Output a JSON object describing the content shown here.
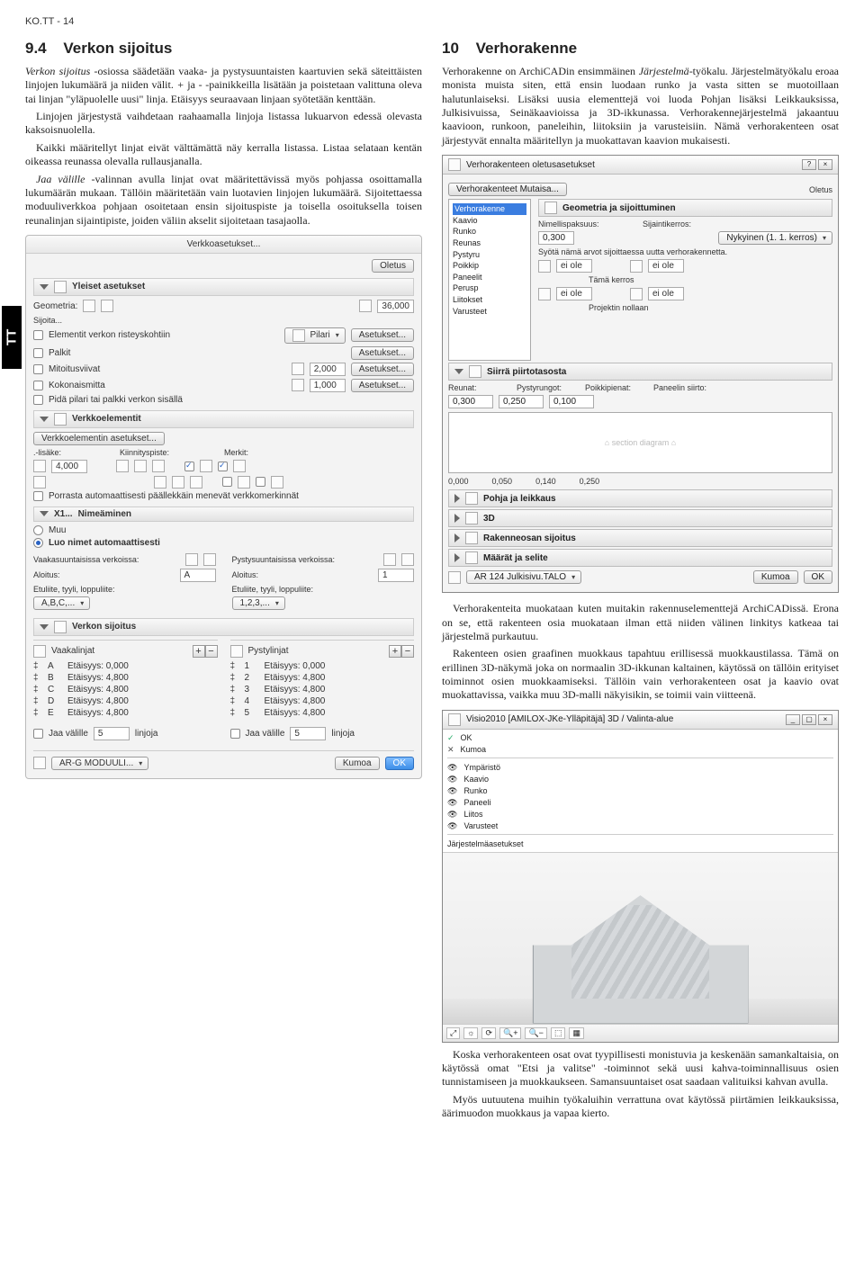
{
  "header": "KO.TT - 14",
  "tab": "TT",
  "left": {
    "sec_num": "9.4",
    "sec_title": "Verkon sijoitus",
    "p1": "Verkon sijoitus -osiossa säädetään vaaka- ja pystysuuntaisten kaartuvien sekä säteittäisten linjojen lukumäärä ja niiden välit. + ja - -painikkeilla lisätään ja poistetaan valittuna oleva tai linjan \"yläpuolelle uusi\" linja. Etäisyys seuraavaan linjaan syötetään kenttään.",
    "p2": "Linjojen järjestystä vaihdetaan raahaamalla linjoja listassa lukuarvon edessä olevasta kaksoisnuolella.",
    "p3": "Kaikki määritellyt linjat eivät välttämättä näy kerralla listassa. Listaa selataan kentän oikeassa reunassa olevalla rullausjanalla.",
    "p4": "Jaa välille -valinnan avulla linjat ovat määritettävissä myös pohjassa osoittamalla lukumäärän mukaan. Tällöin määritetään vain luotavien linjojen lukumäärä. Sijoitettaessa moduuliverkkoa pohjaan osoitetaan ensin sijoituspiste ja toisella osoituksella toisen reunalinjan sijaintipiste, joiden väliin akselit sijoitetaan tasajaolla."
  },
  "dlg1": {
    "title": "Verkkoasetukset...",
    "oletus": "Oletus",
    "yleiset": "Yleiset asetukset",
    "geometria": "Geometria:",
    "geo_val": "36,000",
    "sijoita": "Sijoita...",
    "r1": "Elementit verkon risteyskohtiin",
    "pilari": "Pilari",
    "asetukset": "Asetukset...",
    "r2": "Palkit",
    "r3": "Mitoitusviivat",
    "r3_val": "2,000",
    "r4": "Kokonaismitta",
    "r4_val": "1,000",
    "r5": "Pidä pilari tai palkki verkon sisällä",
    "verkkoelementit": "Verkkoelementit",
    "ve_btn": "Verkkoelementin asetukset...",
    "lisake": ".-lisäke:",
    "lisake_val": "4,000",
    "kiin": "Kiinnityspiste:",
    "merkit": "Merkit:",
    "porrasta": "Porrasta automaattisesti päällekkäin menevät verkkomerkinnät",
    "nimeaminen": "Nimeäminen",
    "x1": "X1...",
    "muu": "Muu",
    "luo": "Luo nimet automaattisesti",
    "vv": "Vaakasuuntaisissa verkoissa:",
    "pv": "Pystysuuntaisissa verkoissa:",
    "aloitus": "Aloitus:",
    "a_v": "A",
    "a_p": "1",
    "etl": "Etuliite, tyyli, loppuliite:",
    "etl_v": "A,B,C,...",
    "etl_p": "1,2,3,...",
    "sijoitus": "Verkon sijoitus",
    "vaakalinjat": "Vaakalinjat",
    "pystylinjat": "Pystylinjat",
    "v_rows": [
      {
        "n": "A",
        "t": "Etäisyys: 0,000"
      },
      {
        "n": "B",
        "t": "Etäisyys: 4,800"
      },
      {
        "n": "C",
        "t": "Etäisyys: 4,800"
      },
      {
        "n": "D",
        "t": "Etäisyys: 4,800"
      },
      {
        "n": "E",
        "t": "Etäisyys: 4,800"
      }
    ],
    "p_rows": [
      {
        "n": "1",
        "t": "Etäisyys: 0,000"
      },
      {
        "n": "2",
        "t": "Etäisyys: 4,800"
      },
      {
        "n": "3",
        "t": "Etäisyys: 4,800"
      },
      {
        "n": "4",
        "t": "Etäisyys: 4,800"
      },
      {
        "n": "5",
        "t": "Etäisyys: 4,800"
      }
    ],
    "jaa": "Jaa välille",
    "jaa_v": "5",
    "linjoja": "linjoja",
    "layer": "AR-G MODUULI...",
    "kumoa": "Kumoa",
    "ok": "OK"
  },
  "right": {
    "sec_num": "10",
    "sec_title": "Verhorakenne",
    "p1": "Verhorakenne on ArchiCADin ensimmäinen Järjestelmä-työkalu. Järjestelmätyökalu eroaa monista muista siten, että ensin luodaan runko ja vasta sitten se muotoillaan halutunlaiseksi. Lisäksi uusia elementtejä voi luoda Pohjan lisäksi Leikkauksissa, Julkisivuissa, Seinäkaavioissa ja 3D-ikkunassa. Verhorakennejärjestelmä jakaantuu kaavioon, runkoon, paneleihin, liitoksiin ja varusteisiin. Nämä verhorakenteen osat järjestyvät ennalta määritellyn ja muokattavan kaavion mukaisesti.",
    "p2": "Verhorakenteita muokataan kuten muitakin rakennuselementtejä ArchiCADissä. Erona on se, että rakenteen osia muokataan ilman että niiden välinen linkitys katkeaa tai järjestelmä purkautuu.",
    "p3": "Rakenteen osien graafinen muokkaus tapahtuu erillisessä muokkaustilassa. Tämä on erillinen 3D-näkymä joka on normaalin 3D-ikkunan kaltainen, käytössä on tällöin erityiset toiminnot osien muokkaamiseksi. Tällöin vain verhorakenteen osat ja kaavio ovat muokattavissa, vaikka muu 3D-malli näkyisikin, se toimii vain viitteenä.",
    "p4": "Koska verhorakenteen osat ovat tyypillisesti monistuvia ja keskenään samankaltaisia, on käytössä omat \"Etsi ja valitse\" -toiminnot sekä uusi kahva-toiminnallisuus osien tunnistamiseen ja muokkaukseen. Samansuuntaiset osat saadaan valituiksi kahvan avulla.",
    "p5": "Myös uutuutena muihin työkaluihin verrattuna ovat käytössä piirtämien leikkauksissa, äärimuodon muokkaus ja vapaa kierto."
  },
  "dlg2": {
    "title": "Verhorakenteen oletusasetukset",
    "mutaisa": "Verhorakenteet Mutaisa...",
    "oletus": "Oletus",
    "tree": [
      "Verhorakenne",
      "Kaavio",
      "Runko",
      "Reunas",
      "Pystyru",
      "Poikkip",
      "Paneelit",
      "Perusp",
      "Liitokset",
      "Varusteet"
    ],
    "bar1": "Geometria ja sijoittuminen",
    "np": "Nimellispaksuus:",
    "np_v": "0,300",
    "sk": "Sijaintikerros:",
    "sk_v": "Nykyinen (1. 1. kerros)",
    "sy": "Syötä nämä arvot sijoittaessa uutta verhorakennetta.",
    "eiole": "ei ole",
    "tl": "Tämä kerros",
    "pn": "Projektin nollaan",
    "bars": "Siirrä piirtotasosta",
    "reunat": "Reunat:",
    "pystyr": "Pystyrungot:",
    "poikkip": "Poikkipienat:",
    "paneelin": "Paneelin siirto:",
    "r_v": "0,300",
    "py_v": "0,250",
    "po_v": "0,100",
    "nums": [
      "0,000",
      "0,050",
      "0,140",
      "0,250"
    ],
    "bar2": "Pohja ja leikkaus",
    "bar3": "3D",
    "bar4": "Rakenneosan sijoitus",
    "bar5": "Määrät ja selite",
    "layer": "AR 124 Julkisivu.TALO",
    "kumoa": "Kumoa",
    "ok": "OK"
  },
  "viewer": {
    "title": "Visio2010 [AMILOX-JKe-Ylläpitäjä] 3D / Valinta-alue",
    "menu": [
      {
        "c": "chk2",
        "t": "OK"
      },
      {
        "c": "x",
        "t": "Kumoa"
      },
      {
        "c": "eye",
        "t": "Ympäristö"
      },
      {
        "c": "eye",
        "t": "Kaavio"
      },
      {
        "c": "eye",
        "t": "Runko"
      },
      {
        "c": "eye",
        "t": "Paneeli"
      },
      {
        "c": "eye",
        "t": "Liitos"
      },
      {
        "c": "eye",
        "t": "Varusteet"
      },
      {
        "c": "",
        "t": "Järjestelmäasetukset"
      }
    ]
  }
}
